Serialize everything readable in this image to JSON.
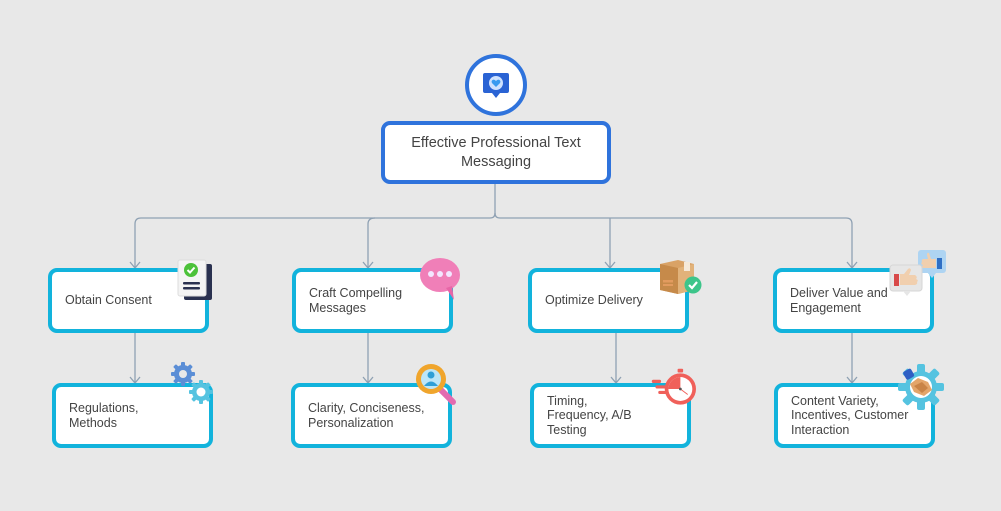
{
  "diagram": {
    "root": {
      "title": "Effective Professional Text Messaging",
      "icon": "heart-message-icon",
      "color": "#2f73dc"
    },
    "node_color": "#12b3dc",
    "connector_color": "#8fa1b3",
    "background": "#e8e8e8",
    "branches": [
      {
        "label": "Obtain Consent",
        "icon": "checklist-document-icon",
        "child": {
          "label": "Regulations, Methods",
          "icon": "gears-icon"
        }
      },
      {
        "label": "Craft Compelling Messages",
        "icon": "speech-bubble-icon",
        "child": {
          "label": "Clarity, Conciseness, Personalization",
          "icon": "magnifier-people-icon"
        }
      },
      {
        "label": "Optimize Delivery",
        "icon": "package-check-icon",
        "child": {
          "label": "Timing, Frequency, A/B Testing",
          "icon": "stopwatch-icon"
        }
      },
      {
        "label": "Deliver Value and Engagement",
        "icon": "thumbs-up-icon",
        "child": {
          "label": "Content Variety, Incentives, Customer Interaction",
          "icon": "handshake-gear-icon"
        }
      }
    ]
  }
}
